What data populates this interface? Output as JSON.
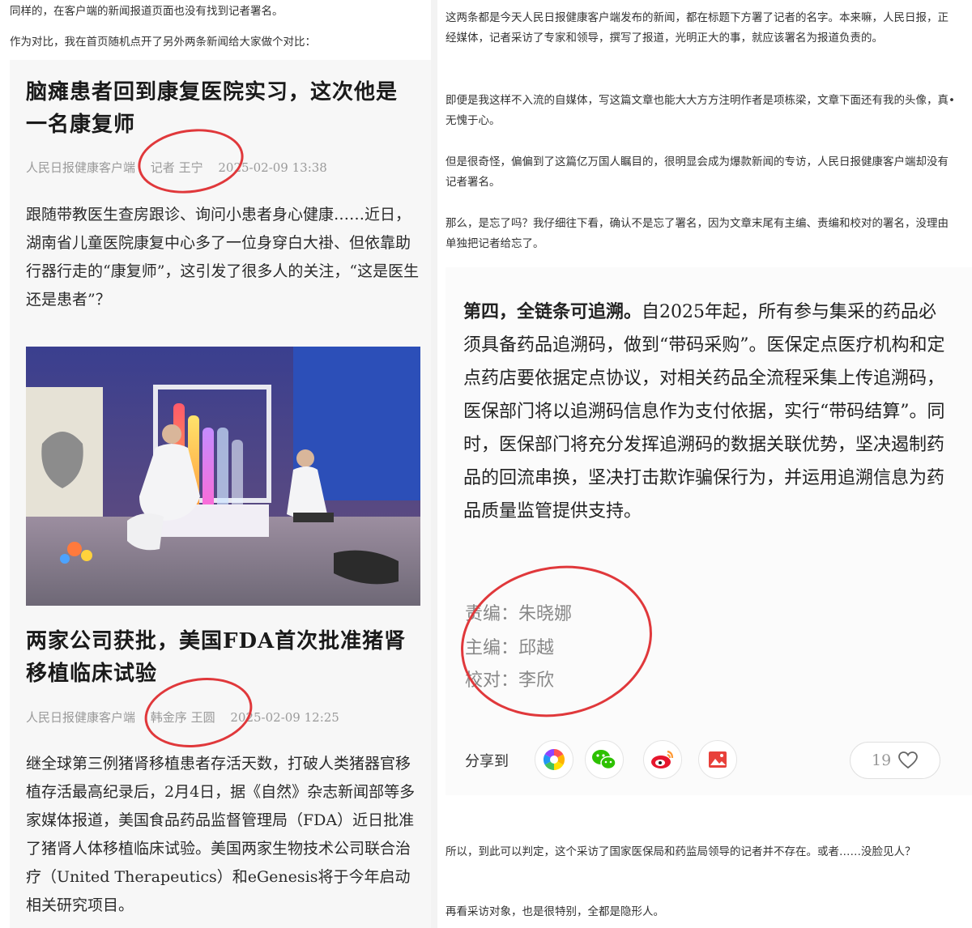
{
  "left": {
    "intro": [
      "同样的，在客户端的新闻报道页面也没有找到记者署名。",
      "作为对比，我在首页随机点开了另外两条新闻给大家做个对比："
    ],
    "article1": {
      "title": "脑瘫患者回到康复医院实习，这次他是一名康复师",
      "source": "人民日报健康客户端",
      "author": "记者 王宁",
      "date": "2025-02-09 13:38",
      "body": "跟随带教医生查房跟诊、询问小患者身心健康……近日，湖南省儿童医院康复中心多了一位身穿白大褂、但依靠助行器行走的“康复师”，这引发了很多人的关注，“这是医生还是患者”？"
    },
    "article2": {
      "title": "两家公司获批，美国FDA首次批准猪肾移植临床试验",
      "source": "人民日报健康客户端",
      "author": "韩金序 王圆",
      "date": "2025-02-09 12:25",
      "body": "继全球第三例猪肾移植患者存活天数，打破人类猪器官移植存活最高纪录后，2月4日，据《自然》杂志新闻部等多家媒体报道，美国食品药品监督管理局（FDA）近日批准了猪肾人体移植临床试验。美国两家生物技术公司联合治疗（United Therapeutics）和eGenesis将于今年启动相关研究项目。"
    }
  },
  "right": {
    "paragraphs": [
      "这两条都是今天人民日报健康客户端发布的新闻，都在标题下方署了记者的名字。本来嘛，人民日报，正经媒体，记者采访了专家和领导，撰写了报道，光明正大的事，就应该署名为报道负责的。",
      "即便是我这样不入流的自媒体，写这篇文章也能大大方方注明作者是项栋梁，文章下面还有我的头像，真•无愧于心。",
      "但是很奇怪，偏偏到了这篇亿万国人瞩目的，很明显会成为爆款新闻的专访，人民日报健康客户端却没有记者署名。",
      "那么，是忘了吗？我仔细往下看，确认不是忘了署名，因为文章末尾有主编、责编和校对的署名，没理由单独把记者给忘了。"
    ],
    "article": {
      "lead": "第四，全链条可追溯。",
      "body": "自2025年起，所有参与集采的药品必须具备药品追溯码，做到“带码采购”。医保定点医疗机构和定点药店要依据定点协议，对相关药品全流程采集上传追溯码，医保部门将以追溯码信息作为支付依据，实行“带码结算”。同时，医保部门将充分发挥追溯码的数据关联优势，坚决遏制药品的回流串换，坚决打击欺诈骗保行为，并运用追溯信息为药品质量监管提供支持。"
    },
    "credits": [
      "责编：朱晓娜",
      "主编：邱越",
      "校对：李欣"
    ],
    "share": {
      "label": "分享到",
      "icons": [
        "moments-icon",
        "wechat-icon",
        "weibo-icon",
        "image-icon"
      ],
      "likes": "19"
    },
    "conclusion": [
      "所以，到此可以判定，这个采访了国家医保局和药监局领导的记者并不存在。或者……没脸见人？",
      "再看采访对象，也是很特别，全都是隐形人。"
    ]
  },
  "colors": {
    "annotation": "#e0383b",
    "meta_gray": "#9a9a9a"
  }
}
